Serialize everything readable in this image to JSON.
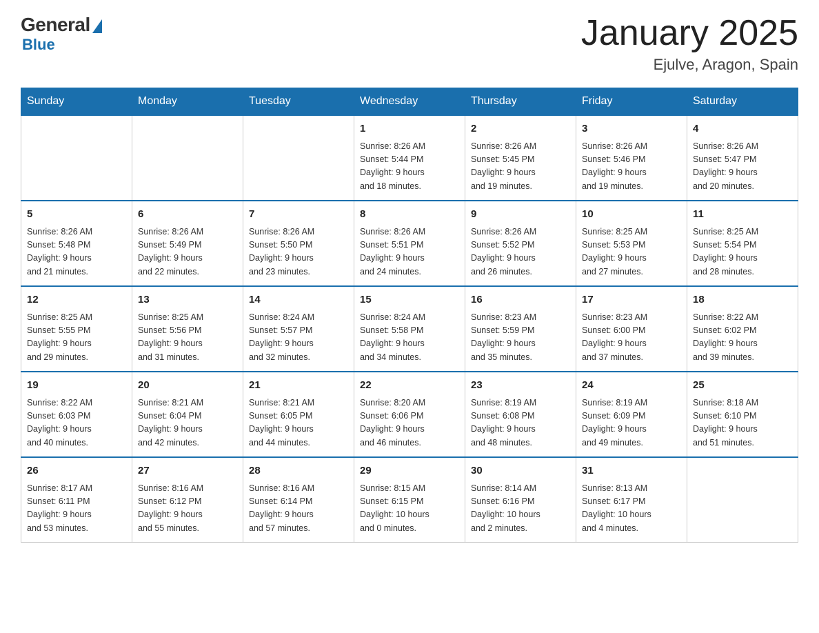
{
  "logo": {
    "general": "General",
    "blue": "Blue"
  },
  "title": "January 2025",
  "location": "Ejulve, Aragon, Spain",
  "days_header": [
    "Sunday",
    "Monday",
    "Tuesday",
    "Wednesday",
    "Thursday",
    "Friday",
    "Saturday"
  ],
  "weeks": [
    [
      {
        "day": "",
        "info": ""
      },
      {
        "day": "",
        "info": ""
      },
      {
        "day": "",
        "info": ""
      },
      {
        "day": "1",
        "info": "Sunrise: 8:26 AM\nSunset: 5:44 PM\nDaylight: 9 hours\nand 18 minutes."
      },
      {
        "day": "2",
        "info": "Sunrise: 8:26 AM\nSunset: 5:45 PM\nDaylight: 9 hours\nand 19 minutes."
      },
      {
        "day": "3",
        "info": "Sunrise: 8:26 AM\nSunset: 5:46 PM\nDaylight: 9 hours\nand 19 minutes."
      },
      {
        "day": "4",
        "info": "Sunrise: 8:26 AM\nSunset: 5:47 PM\nDaylight: 9 hours\nand 20 minutes."
      }
    ],
    [
      {
        "day": "5",
        "info": "Sunrise: 8:26 AM\nSunset: 5:48 PM\nDaylight: 9 hours\nand 21 minutes."
      },
      {
        "day": "6",
        "info": "Sunrise: 8:26 AM\nSunset: 5:49 PM\nDaylight: 9 hours\nand 22 minutes."
      },
      {
        "day": "7",
        "info": "Sunrise: 8:26 AM\nSunset: 5:50 PM\nDaylight: 9 hours\nand 23 minutes."
      },
      {
        "day": "8",
        "info": "Sunrise: 8:26 AM\nSunset: 5:51 PM\nDaylight: 9 hours\nand 24 minutes."
      },
      {
        "day": "9",
        "info": "Sunrise: 8:26 AM\nSunset: 5:52 PM\nDaylight: 9 hours\nand 26 minutes."
      },
      {
        "day": "10",
        "info": "Sunrise: 8:25 AM\nSunset: 5:53 PM\nDaylight: 9 hours\nand 27 minutes."
      },
      {
        "day": "11",
        "info": "Sunrise: 8:25 AM\nSunset: 5:54 PM\nDaylight: 9 hours\nand 28 minutes."
      }
    ],
    [
      {
        "day": "12",
        "info": "Sunrise: 8:25 AM\nSunset: 5:55 PM\nDaylight: 9 hours\nand 29 minutes."
      },
      {
        "day": "13",
        "info": "Sunrise: 8:25 AM\nSunset: 5:56 PM\nDaylight: 9 hours\nand 31 minutes."
      },
      {
        "day": "14",
        "info": "Sunrise: 8:24 AM\nSunset: 5:57 PM\nDaylight: 9 hours\nand 32 minutes."
      },
      {
        "day": "15",
        "info": "Sunrise: 8:24 AM\nSunset: 5:58 PM\nDaylight: 9 hours\nand 34 minutes."
      },
      {
        "day": "16",
        "info": "Sunrise: 8:23 AM\nSunset: 5:59 PM\nDaylight: 9 hours\nand 35 minutes."
      },
      {
        "day": "17",
        "info": "Sunrise: 8:23 AM\nSunset: 6:00 PM\nDaylight: 9 hours\nand 37 minutes."
      },
      {
        "day": "18",
        "info": "Sunrise: 8:22 AM\nSunset: 6:02 PM\nDaylight: 9 hours\nand 39 minutes."
      }
    ],
    [
      {
        "day": "19",
        "info": "Sunrise: 8:22 AM\nSunset: 6:03 PM\nDaylight: 9 hours\nand 40 minutes."
      },
      {
        "day": "20",
        "info": "Sunrise: 8:21 AM\nSunset: 6:04 PM\nDaylight: 9 hours\nand 42 minutes."
      },
      {
        "day": "21",
        "info": "Sunrise: 8:21 AM\nSunset: 6:05 PM\nDaylight: 9 hours\nand 44 minutes."
      },
      {
        "day": "22",
        "info": "Sunrise: 8:20 AM\nSunset: 6:06 PM\nDaylight: 9 hours\nand 46 minutes."
      },
      {
        "day": "23",
        "info": "Sunrise: 8:19 AM\nSunset: 6:08 PM\nDaylight: 9 hours\nand 48 minutes."
      },
      {
        "day": "24",
        "info": "Sunrise: 8:19 AM\nSunset: 6:09 PM\nDaylight: 9 hours\nand 49 minutes."
      },
      {
        "day": "25",
        "info": "Sunrise: 8:18 AM\nSunset: 6:10 PM\nDaylight: 9 hours\nand 51 minutes."
      }
    ],
    [
      {
        "day": "26",
        "info": "Sunrise: 8:17 AM\nSunset: 6:11 PM\nDaylight: 9 hours\nand 53 minutes."
      },
      {
        "day": "27",
        "info": "Sunrise: 8:16 AM\nSunset: 6:12 PM\nDaylight: 9 hours\nand 55 minutes."
      },
      {
        "day": "28",
        "info": "Sunrise: 8:16 AM\nSunset: 6:14 PM\nDaylight: 9 hours\nand 57 minutes."
      },
      {
        "day": "29",
        "info": "Sunrise: 8:15 AM\nSunset: 6:15 PM\nDaylight: 10 hours\nand 0 minutes."
      },
      {
        "day": "30",
        "info": "Sunrise: 8:14 AM\nSunset: 6:16 PM\nDaylight: 10 hours\nand 2 minutes."
      },
      {
        "day": "31",
        "info": "Sunrise: 8:13 AM\nSunset: 6:17 PM\nDaylight: 10 hours\nand 4 minutes."
      },
      {
        "day": "",
        "info": ""
      }
    ]
  ]
}
